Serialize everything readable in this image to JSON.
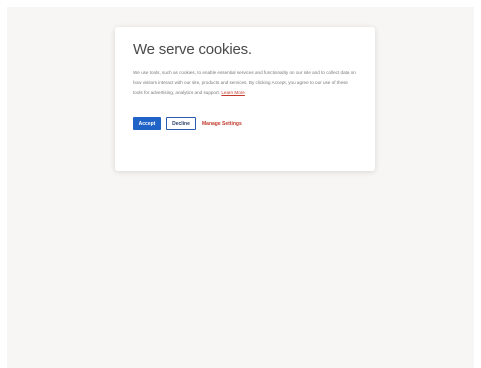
{
  "cookie_banner": {
    "title": "We serve cookies.",
    "body_text": "We use tools, such as cookies, to enable essential services and functionality on our site and to collect data on how visitors interact with our site, products and services. By clicking Accept, you agree to our use of these tools for advertising, analytics and support.",
    "learn_more_label": "Learn More",
    "accept_label": "Accept",
    "decline_label": "Decline",
    "manage_settings_label": "Manage Settings"
  },
  "colors": {
    "accent": "#1f63c7",
    "link": "#c0392b",
    "page_background": "#f7f6f4"
  }
}
